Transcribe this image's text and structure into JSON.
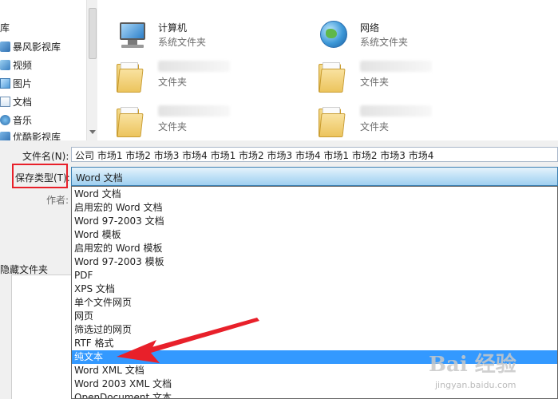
{
  "nav": {
    "items": [
      {
        "label": "库",
        "icon": "library-icon"
      },
      {
        "label": "暴风影视库",
        "icon": "video-library-icon"
      },
      {
        "label": "视频",
        "icon": "video-icon"
      },
      {
        "label": "图片",
        "icon": "picture-icon"
      },
      {
        "label": "文档",
        "icon": "document-icon"
      },
      {
        "label": "音乐",
        "icon": "music-icon"
      },
      {
        "label": "优酷影视库",
        "icon": "video-library-icon"
      }
    ]
  },
  "tiles": [
    {
      "name": "计算机",
      "type": "系统文件夹",
      "icon": "computer-icon"
    },
    {
      "name": "网络",
      "type": "系统文件夹",
      "icon": "network-globe-icon"
    },
    {
      "name": "",
      "type": "文件夹",
      "icon": "folder-icon"
    },
    {
      "name": "",
      "type": "文件夹",
      "icon": "folder-icon"
    },
    {
      "name": "",
      "type": "文件夹",
      "icon": "folder-icon"
    },
    {
      "name": "",
      "type": "文件夹",
      "icon": "folder-icon"
    }
  ],
  "form": {
    "filename_label": "文件名(N):",
    "filename_value": "公司 市场1 市场2 市场3 市场4 市场1 市场2 市场3 市场4 市场1 市场2 市场3 市场4",
    "savetype_label": "保存类型(T):",
    "savetype_value": "Word 文档",
    "author_label": "作者:",
    "hide_folders_label": "隐藏文件夹"
  },
  "dropdown": {
    "options": [
      "Word 文档",
      "启用宏的 Word 文档",
      "Word 97-2003 文档",
      "Word 模板",
      "启用宏的 Word 模板",
      "Word 97-2003 模板",
      "PDF",
      "XPS 文档",
      "单个文件网页",
      "网页",
      "筛选过的网页",
      "RTF 格式",
      "纯文本",
      "Word XML 文档",
      "Word 2003 XML 文档",
      "OpenDocument 文本"
    ],
    "selected_index": 12
  },
  "colors": {
    "selection": "#3399ff",
    "highlight_box": "#e8202a",
    "arrow": "#e8202a"
  },
  "watermark": {
    "brand": "Bai 经验",
    "site": "jingyan.baidu.com"
  }
}
